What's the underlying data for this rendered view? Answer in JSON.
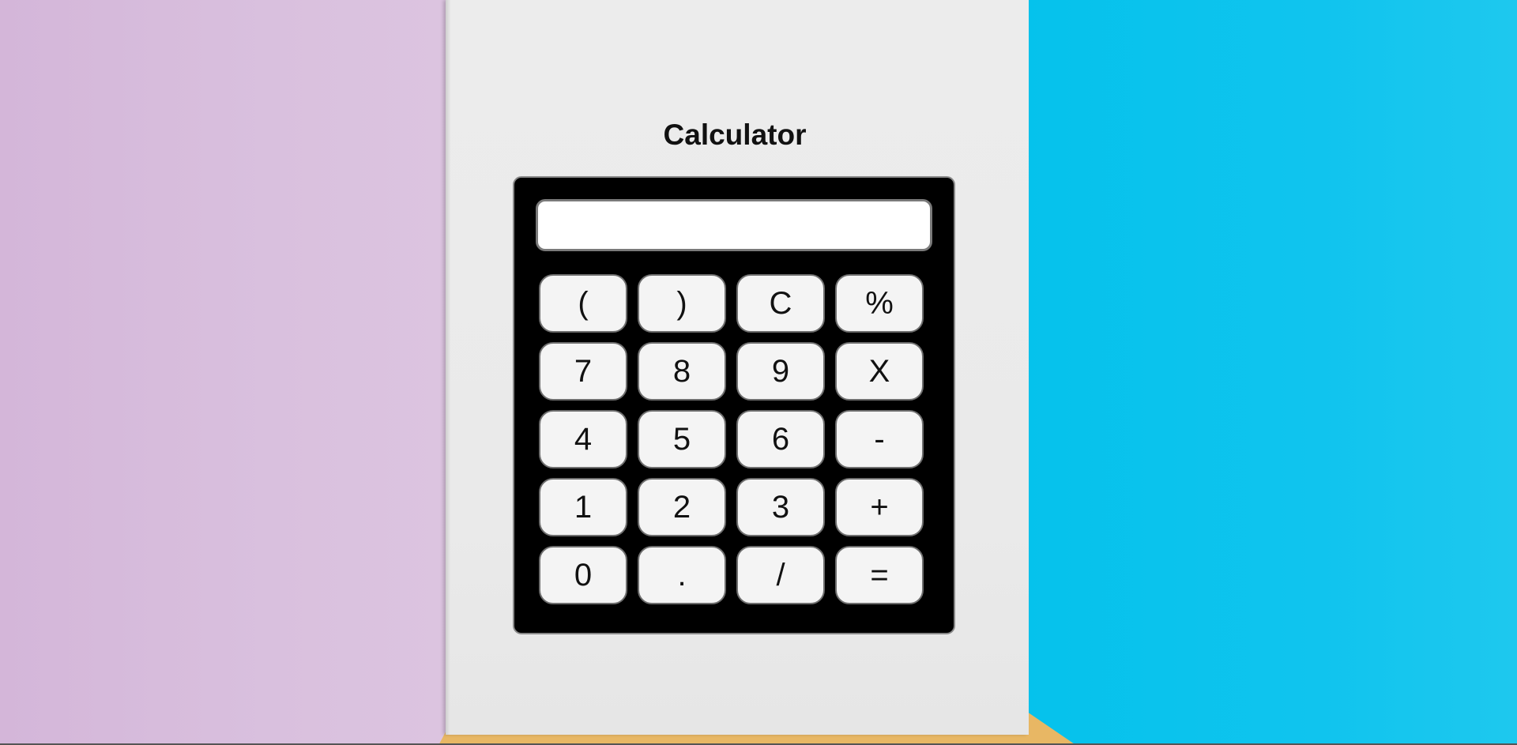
{
  "page": {
    "title": "Calculator"
  },
  "display": {
    "value": ""
  },
  "keys": [
    "(",
    ")",
    "C",
    "%",
    "7",
    "8",
    "9",
    "X",
    "4",
    "5",
    "6",
    "-",
    "1",
    "2",
    "3",
    "+",
    "0",
    ".",
    "/",
    "="
  ],
  "colors": {
    "calculator_body": "#000000",
    "key_background": "#f4f4f4",
    "background_left": "#d7bcdc",
    "background_right": "#08c3ec",
    "background_bottom": "#e8b764",
    "paper": "#ebebeb"
  }
}
